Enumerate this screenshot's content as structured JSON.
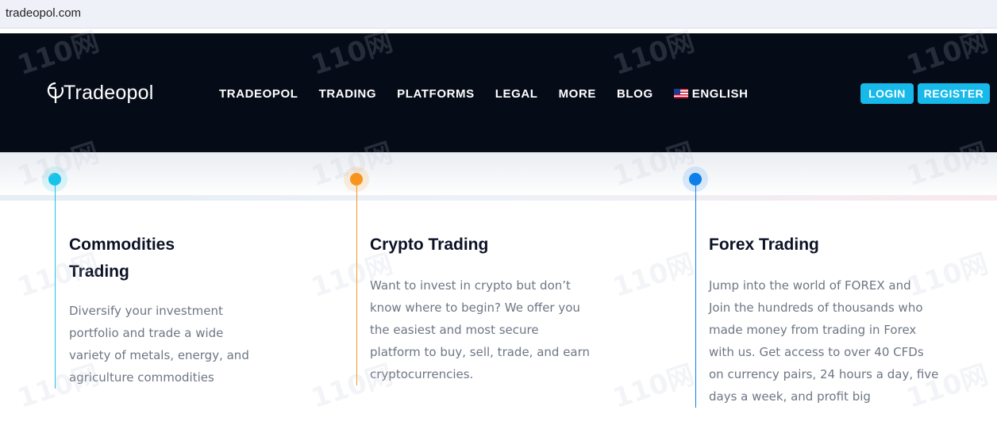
{
  "browser": {
    "url": "tradeopol.com"
  },
  "header": {
    "logo_text": "Tradeopol",
    "nav": [
      {
        "label": "TRADEOPOL"
      },
      {
        "label": "TRADING"
      },
      {
        "label": "PLATFORMS"
      },
      {
        "label": "LEGAL"
      },
      {
        "label": "MORE"
      },
      {
        "label": "BLOG"
      },
      {
        "label": "ENGLISH",
        "icon": "us-flag-icon"
      }
    ],
    "login_label": "LOGIN",
    "register_label": "REGISTER"
  },
  "colors": {
    "header_bg": "#060b18",
    "accent": "#16b9e9",
    "commodities": "#17c3e8",
    "crypto": "#f7941d",
    "forex": "#0d7fe8"
  },
  "cards": [
    {
      "title_line1": "Commodities",
      "title_line2": "Trading",
      "text_lines": [
        "Diversify your investment",
        "portfolio and trade a wide",
        "variety of metals, energy, and",
        "agriculture commodities"
      ]
    },
    {
      "title_line1": "Crypto Trading",
      "text_lines": [
        "Want to invest in crypto but don’t",
        "know where to begin? We offer you",
        "the easiest and most secure",
        "platform to buy, sell, trade, and earn",
        "cryptocurrencies."
      ]
    },
    {
      "title_line1": "Forex Trading",
      "text_lines": [
        "Jump into the world of FOREX and",
        "Join the hundreds of thousands who",
        "made money from trading in Forex",
        "with us. Get access to over 40 CFDs",
        "on currency pairs, 24 hours a day, five",
        "days a week, and profit big"
      ]
    }
  ],
  "watermark_text": "110网"
}
